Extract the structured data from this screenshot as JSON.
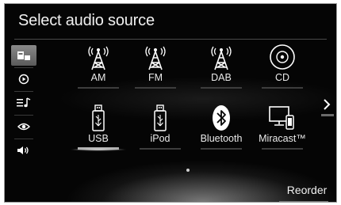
{
  "header": {
    "title": "Select audio source"
  },
  "sidebar": {
    "items": [
      {
        "icon": "audio-source-icon",
        "active": true
      },
      {
        "icon": "play-icon",
        "active": false
      },
      {
        "icon": "music-list-icon",
        "active": false
      },
      {
        "icon": "eye-icon",
        "active": false
      },
      {
        "icon": "speaker-volume-icon",
        "active": false
      }
    ]
  },
  "sources": [
    {
      "label": "AM",
      "icon": "radio-tower-icon"
    },
    {
      "label": "FM",
      "icon": "radio-tower-icon"
    },
    {
      "label": "DAB",
      "icon": "radio-tower-icon"
    },
    {
      "label": "CD",
      "icon": "disc-icon"
    },
    {
      "label": "USB",
      "icon": "usb-icon",
      "selected": true
    },
    {
      "label": "iPod",
      "icon": "usb-icon"
    },
    {
      "label": "Bluetooth",
      "icon": "bluetooth-icon"
    },
    {
      "label": "Miracast™",
      "icon": "miracast-icon"
    }
  ],
  "footer": {
    "reorder_label": "Reorder"
  },
  "colors": {
    "background": "#050505",
    "text": "#eaeaea",
    "accent": "#aaaaaa"
  }
}
